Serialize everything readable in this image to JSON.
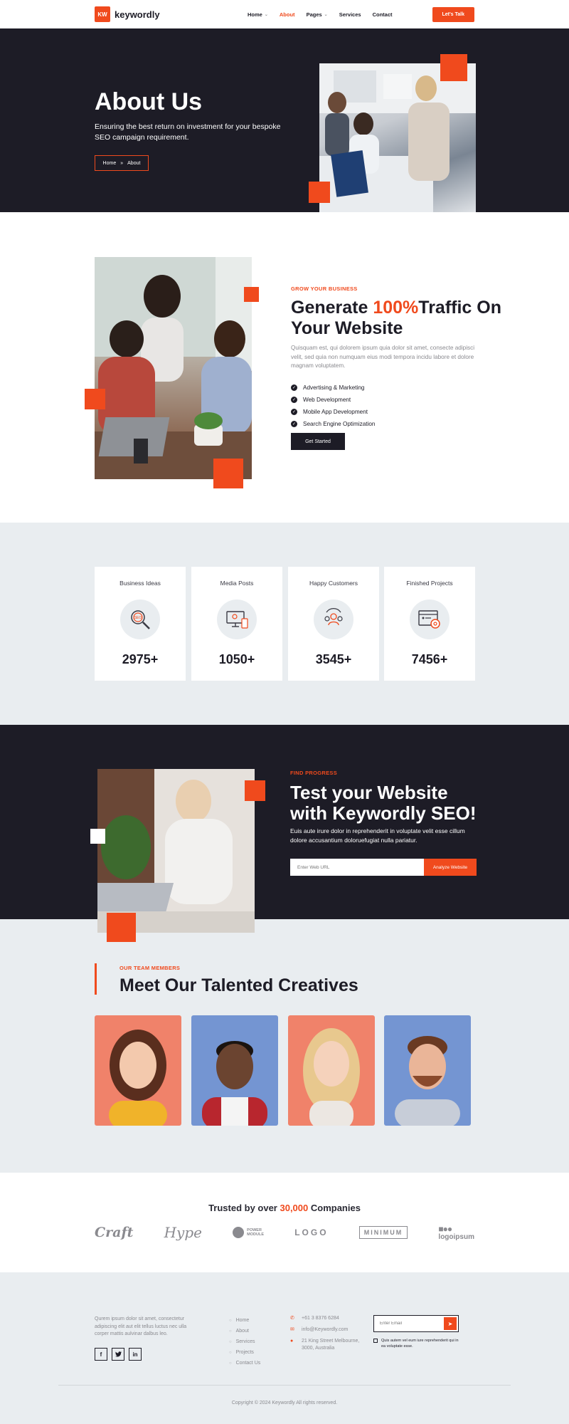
{
  "header": {
    "logo_mark": "KW",
    "logo_text": "keywordly",
    "nav": [
      {
        "label": "Home",
        "has_dropdown": true,
        "active": false
      },
      {
        "label": "About",
        "has_dropdown": false,
        "active": true
      },
      {
        "label": "Pages",
        "has_dropdown": true,
        "active": false
      },
      {
        "label": "Services",
        "has_dropdown": false,
        "active": false
      },
      {
        "label": "Contact",
        "has_dropdown": false,
        "active": false
      }
    ],
    "cta": "Let's Talk"
  },
  "hero": {
    "title": "About Us",
    "subtitle": "Ensuring the best return on investment for your bespoke SEO campaign requirement.",
    "breadcrumb": {
      "home": "Home",
      "separator": "»",
      "current": "About"
    }
  },
  "about": {
    "kicker": "GROW YOUR BUSINESS",
    "title_part1": "Generate ",
    "title_highlight": "100%",
    "title_part2": "Traffic On Your Website",
    "text": "Quisquam est, qui dolorem ipsum quia dolor sit amet, consecte adipisci velit, sed quia non numquam eius modi tempora incidu labore et dolore magnam voluptatem.",
    "features": [
      "Advertising & Marketing",
      "Web Development",
      "Mobile App Development",
      "Search Engine Optimization"
    ],
    "button": "Get Started"
  },
  "stats": [
    {
      "label": "Business Ideas",
      "value": "2975+",
      "icon": "seo-magnifier-icon"
    },
    {
      "label": "Media Posts",
      "value": "1050+",
      "icon": "devices-icon"
    },
    {
      "label": "Happy Customers",
      "value": "3545+",
      "icon": "customers-icon"
    },
    {
      "label": "Finished Projects",
      "value": "7456+",
      "icon": "gear-browser-icon"
    }
  ],
  "test": {
    "kicker": "FIND PROGRESS",
    "title": "Test your Website with Keywordly SEO!",
    "text": "Euis aute irure dolor in reprehenderit in voluptate velit esse cillum dolore accusantium doloruefugiat nulla pariatur.",
    "input_placeholder": "Enter Web URL",
    "button": "Analyze Website"
  },
  "team": {
    "kicker": "OUR TEAM MEMBERS",
    "title": "Meet Our Talented Creatives"
  },
  "trusted": {
    "prefix": "Trusted by over ",
    "highlight": "30,000",
    "suffix": " Companies",
    "logos": {
      "craft": "Craft",
      "hype": "Hype",
      "power_line1": "POWER",
      "power_line2": "MODULE",
      "logo": "LOGO",
      "minimum": "MINIMUM",
      "logoipsum": "logoipsum"
    }
  },
  "footer": {
    "about": "Qurem ipsum dolor sit amet, consectetur adipiscing elit aut elit tellus luctus nec ulla corper mattis aulvinar dalbus leo.",
    "socials": [
      "f",
      "t",
      "in"
    ],
    "links": [
      "Home",
      "About",
      "Services",
      "Projects",
      "Contact Us"
    ],
    "phone": "+61 3 8376 6284",
    "email": "info@Keywordly.com",
    "address": "21 King Street Melbourne, 3000, Australia",
    "subscribe_placeholder": "Enter Email",
    "agree_text": "Quis autem vel eum iure reprehenderit qui in ea voluptate esse.",
    "copyright": "Copyright © 2024 Keywordly All rights reserved."
  },
  "colors": {
    "accent": "#f04a1d",
    "dark": "#1d1c26",
    "light_bg": "#e9edf0"
  }
}
